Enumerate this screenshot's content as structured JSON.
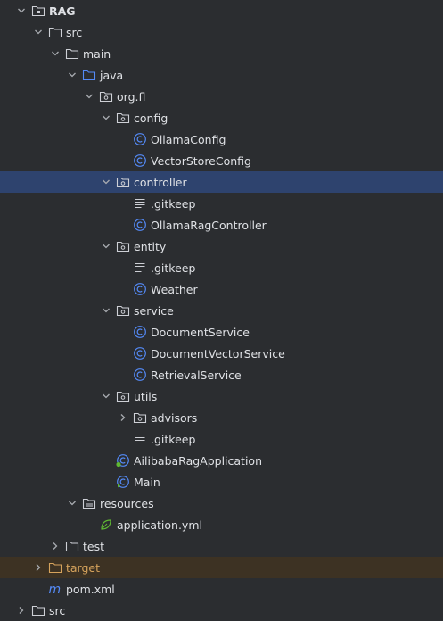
{
  "project_tree": {
    "rows": [
      {
        "label": "RAG",
        "icon": "project-folder-icon",
        "depth": 0,
        "expanded": true,
        "bold": true
      },
      {
        "label": "src",
        "icon": "folder-icon",
        "depth": 1,
        "expanded": true
      },
      {
        "label": "main",
        "icon": "folder-icon",
        "depth": 2,
        "expanded": true
      },
      {
        "label": "java",
        "icon": "source-root-folder-icon",
        "depth": 3,
        "expanded": true
      },
      {
        "label": "org.fl",
        "icon": "package-icon",
        "depth": 4,
        "expanded": true
      },
      {
        "label": "config",
        "icon": "package-icon",
        "depth": 5,
        "expanded": true
      },
      {
        "label": "OllamaConfig",
        "icon": "java-class-icon",
        "depth": 6
      },
      {
        "label": "VectorStoreConfig",
        "icon": "java-class-icon",
        "depth": 6
      },
      {
        "label": "controller",
        "icon": "package-icon",
        "depth": 5,
        "expanded": true,
        "selected": true
      },
      {
        "label": ".gitkeep",
        "icon": "text-file-icon",
        "depth": 6
      },
      {
        "label": "OllamaRagController",
        "icon": "java-class-icon",
        "depth": 6
      },
      {
        "label": "entity",
        "icon": "package-icon",
        "depth": 5,
        "expanded": true
      },
      {
        "label": ".gitkeep",
        "icon": "text-file-icon",
        "depth": 6
      },
      {
        "label": "Weather",
        "icon": "java-class-icon",
        "depth": 6
      },
      {
        "label": "service",
        "icon": "package-icon",
        "depth": 5,
        "expanded": true
      },
      {
        "label": "DocumentService",
        "icon": "java-class-icon",
        "depth": 6
      },
      {
        "label": "DocumentVectorService",
        "icon": "java-class-icon",
        "depth": 6
      },
      {
        "label": "RetrievalService",
        "icon": "java-class-icon",
        "depth": 6
      },
      {
        "label": "utils",
        "icon": "package-icon",
        "depth": 5,
        "expanded": true
      },
      {
        "label": "advisors",
        "icon": "package-icon",
        "depth": 6,
        "expanded": false
      },
      {
        "label": ".gitkeep",
        "icon": "text-file-icon",
        "depth": 6
      },
      {
        "label": "AilibabaRagApplication",
        "icon": "spring-boot-class-icon",
        "depth": 5
      },
      {
        "label": "Main",
        "icon": "java-main-class-icon",
        "depth": 5
      },
      {
        "label": "resources",
        "icon": "resources-folder-icon",
        "depth": 3,
        "expanded": true
      },
      {
        "label": "application.yml",
        "icon": "spring-yaml-icon",
        "depth": 4
      },
      {
        "label": "test",
        "icon": "folder-icon",
        "depth": 2,
        "expanded": false
      },
      {
        "label": "target",
        "icon": "excluded-folder-icon",
        "depth": 1,
        "expanded": false,
        "excluded": true
      },
      {
        "label": "pom.xml",
        "icon": "maven-icon",
        "depth": 1
      },
      {
        "label": "src",
        "icon": "folder-icon",
        "depth": 0,
        "expanded": false
      }
    ],
    "colors": {
      "background": "#2b2d30",
      "selected_row": "#2e436e",
      "excluded_row": "#3d3223",
      "text": "#dfe1e5",
      "excluded_text": "#d6a35c",
      "class_icon": "#548af7",
      "folder_icon": "#ced0d6",
      "maven_icon": "#548af7",
      "spring_icon": "#5fb832"
    }
  }
}
